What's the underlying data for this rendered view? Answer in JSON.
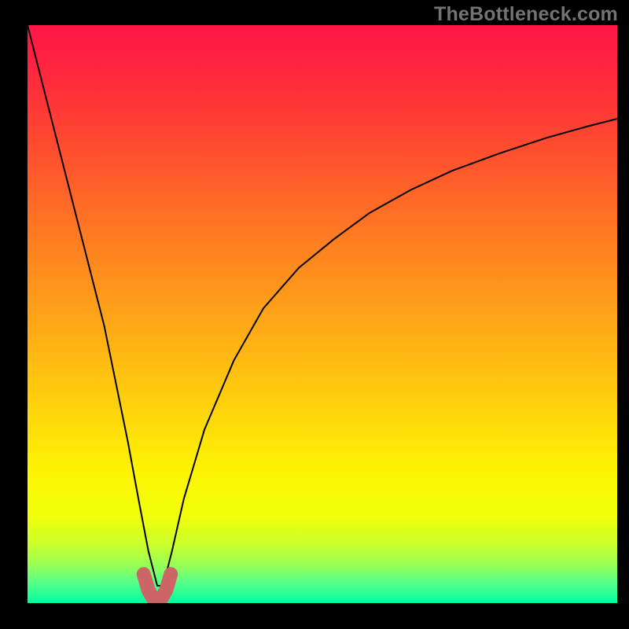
{
  "watermark": "TheBottleneck.com",
  "chart_data": {
    "type": "line",
    "title": "",
    "xlabel": "",
    "ylabel": "",
    "xlim": [
      0,
      100
    ],
    "ylim": [
      0,
      100
    ],
    "grid": false,
    "legend": null,
    "background_gradient": {
      "direction": "vertical",
      "stops": [
        {
          "pos": 0.0,
          "color": "#ff1647"
        },
        {
          "pos": 0.08,
          "color": "#ff263e"
        },
        {
          "pos": 0.2,
          "color": "#ff4930"
        },
        {
          "pos": 0.35,
          "color": "#ff7623"
        },
        {
          "pos": 0.5,
          "color": "#ffa318"
        },
        {
          "pos": 0.65,
          "color": "#ffcf0d"
        },
        {
          "pos": 0.78,
          "color": "#fdf603"
        },
        {
          "pos": 0.85,
          "color": "#f1ff0a"
        },
        {
          "pos": 0.9,
          "color": "#c8ff2e"
        },
        {
          "pos": 0.935,
          "color": "#96ff56"
        },
        {
          "pos": 0.965,
          "color": "#55ff8a"
        },
        {
          "pos": 1.0,
          "color": "#00ff9f"
        }
      ]
    },
    "series": [
      {
        "name": "curve",
        "description": "V-shaped bottleneck curve with sharp minimum near x≈22",
        "x": [
          0,
          4,
          7,
          10,
          13,
          15,
          17,
          19,
          20.5,
          22,
          23,
          24.5,
          26.5,
          30,
          35,
          40,
          46,
          52,
          58,
          65,
          72,
          80,
          88,
          95,
          100
        ],
        "y": [
          100,
          84,
          72,
          60,
          48,
          38,
          28,
          17,
          9,
          3,
          3,
          9,
          18,
          30,
          42,
          51,
          58,
          63,
          67.5,
          71.5,
          74.8,
          77.8,
          80.5,
          82.5,
          83.8
        ],
        "color": "#000000",
        "width": 2
      },
      {
        "name": "lowlight",
        "description": "salmon thick overlay at curve minimum",
        "x": [
          19.7,
          20.5,
          21.3,
          22.0,
          22.7,
          23.5,
          24.3
        ],
        "y": [
          5.0,
          2.2,
          0.8,
          0.5,
          0.8,
          2.2,
          5.0
        ],
        "color": "#cc6666",
        "width": 18,
        "cap": "round"
      }
    ]
  }
}
